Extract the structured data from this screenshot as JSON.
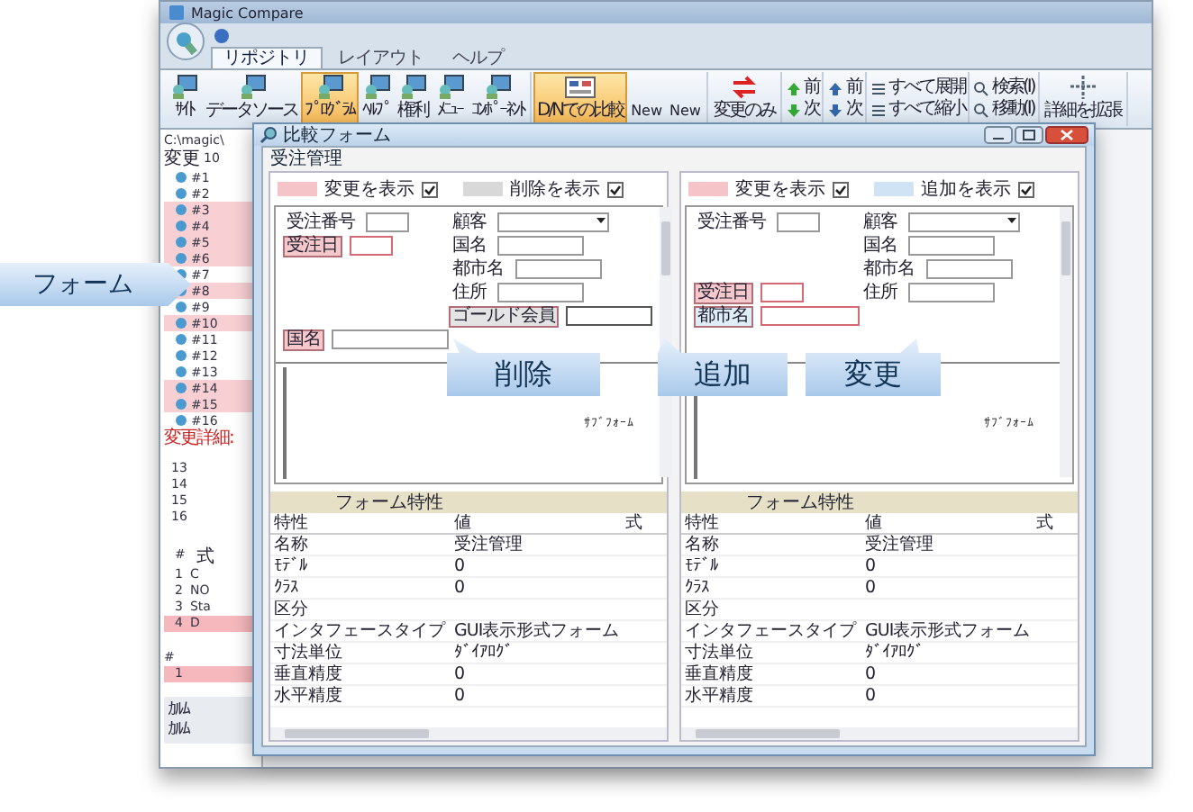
{
  "app": {
    "title": "Magic Compare",
    "tabs": [
      {
        "label": "リポジトリ",
        "selected": true
      },
      {
        "label": "レイアウト",
        "selected": false
      },
      {
        "label": "ヘルプ",
        "selected": false
      }
    ],
    "ribbon": [
      {
        "items": [
          {
            "kind": "large",
            "label": "ｻｲﾄ",
            "selected": false
          },
          {
            "kind": "large",
            "label": "データソース",
            "selected": false
          },
          {
            "kind": "large",
            "label": "ﾌﾟﾛｸﾞﾗﾑ",
            "selected": true
          },
          {
            "kind": "large",
            "label": "ﾍﾙﾌﾟ",
            "selected": false
          },
          {
            "kind": "large",
            "label": "権利",
            "selected": false
          },
          {
            "kind": "large",
            "label": "ﾒﾆｭｰ",
            "selected": false
          },
          {
            "kind": "large",
            "label": "ｺﾝﾎﾟｰﾈﾝﾄ",
            "selected": false
          }
        ]
      },
      {
        "items": [
          {
            "kind": "large",
            "label": "D/Nでの比較",
            "selected": true
          },
          {
            "kind": "text",
            "label": "New"
          },
          {
            "kind": "text",
            "label": "New"
          }
        ]
      },
      {
        "items": [
          {
            "kind": "large",
            "label": "変更のみ",
            "selected": false
          }
        ]
      },
      {
        "items": [
          {
            "kind": "small",
            "label": "前"
          },
          {
            "kind": "small",
            "label": "次"
          }
        ]
      },
      {
        "items": [
          {
            "kind": "small",
            "label": "前"
          },
          {
            "kind": "small",
            "label": "次"
          }
        ]
      },
      {
        "items": [
          {
            "kind": "small",
            "label": "すべて展開"
          },
          {
            "kind": "small",
            "label": "すべて縮小"
          }
        ]
      },
      {
        "items": [
          {
            "kind": "small",
            "label": "検索(I)"
          },
          {
            "kind": "small",
            "label": "移動(I)"
          }
        ]
      },
      {
        "items": [
          {
            "kind": "large",
            "label": "詳細を拡張",
            "selected": false
          }
        ]
      }
    ],
    "path": "C:\\magic\\",
    "changes_label": "変更",
    "changes_count": "10",
    "tree": [
      {
        "label": "#1",
        "highlight": false
      },
      {
        "label": "#2",
        "highlight": false
      },
      {
        "label": "#3",
        "highlight": true
      },
      {
        "label": "#4",
        "highlight": true
      },
      {
        "label": "#5",
        "highlight": true
      },
      {
        "label": "#6",
        "highlight": true
      },
      {
        "label": "#7",
        "highlight": false
      },
      {
        "label": "#8",
        "highlight": true
      },
      {
        "label": "#9",
        "highlight": false
      },
      {
        "label": "#10",
        "highlight": true
      },
      {
        "label": "#11",
        "highlight": false
      },
      {
        "label": "#12",
        "highlight": false
      },
      {
        "label": "#13",
        "highlight": false
      },
      {
        "label": "#14",
        "highlight": true
      },
      {
        "label": "#15",
        "highlight": true
      },
      {
        "label": "#16",
        "highlight": false
      }
    ],
    "detail_label": "変更詳細:",
    "lines": [
      "13",
      "14",
      "15",
      "16"
    ],
    "expr_header": [
      "#",
      "式"
    ],
    "expressions": [
      {
        "num": "1",
        "text": "C",
        "highlight": false
      },
      {
        "num": "2",
        "text": "NO",
        "highlight": false
      },
      {
        "num": "3",
        "text": "Sta",
        "highlight": false
      },
      {
        "num": "4",
        "text": "D",
        "highlight": true
      }
    ],
    "column_header": "#",
    "column_rows": [
      {
        "num": "1",
        "highlight": true
      }
    ],
    "footer": [
      "ｶﾙﾑ",
      "ｶﾙﾑ"
    ]
  },
  "dialog": {
    "title": "比較フォーム",
    "form_name": "受注管理",
    "panes": [
      {
        "legend": [
          {
            "label": "変更を表示",
            "color": "#f4c4c8",
            "checked": true
          },
          {
            "label": "削除を表示",
            "color": "#d8d8d8",
            "checked": true
          }
        ],
        "rows": [
          {
            "left": {
              "kind": "text",
              "label": {
                "text": "受注番号"
              }
            },
            "right": {
              "kind": "combo",
              "label": {
                "text": "顧客"
              }
            }
          },
          {
            "left": {
              "kind": "text",
              "label": {
                "text": "受注日",
                "color": "#f6c8cc"
              },
              "field": {
                "color": "#d46a74"
              }
            },
            "right": {
              "kind": "text",
              "label": {
                "text": "国名"
              }
            }
          },
          {
            "right": {
              "kind": "text",
              "label": {
                "text": "都市名"
              }
            }
          },
          {
            "right": {
              "kind": "text",
              "label": {
                "text": "住所"
              }
            }
          },
          {
            "right": {
              "kind": "text",
              "label": {
                "text": "ゴールド会員",
                "color": "#e4e4e4"
              },
              "field": {
                "color": "#555555"
              }
            }
          },
          {
            "left": {
              "kind": "wide",
              "label": {
                "text": "国名",
                "color": "#f6c8cc"
              }
            }
          }
        ],
        "subform": "ｻﾌﾞﾌｫｰﾑ",
        "section": "フォーム特性",
        "columns": [
          "特性",
          "値",
          "式"
        ],
        "properties": [
          {
            "name": "名称",
            "value": "受注管理"
          },
          {
            "name": "ﾓﾃﾞﾙ",
            "value": "0"
          },
          {
            "name": "ｸﾗｽ",
            "value": "0"
          },
          {
            "name": "区分"
          },
          {
            "name": "インタフェースタイプ",
            "value": "GUI表示形式フォーム"
          },
          {
            "name": "寸法単位",
            "value": "ﾀﾞｲｱﾛｸﾞ"
          },
          {
            "name": "垂直精度",
            "value": "0"
          },
          {
            "name": "水平精度",
            "value": "0"
          }
        ]
      },
      {
        "legend": [
          {
            "label": "変更を表示",
            "color": "#f4c4c8",
            "checked": true
          },
          {
            "label": "追加を表示",
            "color": "#cfe3f5",
            "checked": true
          }
        ],
        "rows": [
          {
            "left": {
              "kind": "text",
              "label": {
                "text": "受注番号"
              }
            },
            "right": {
              "kind": "combo",
              "label": {
                "text": "顧客"
              }
            }
          },
          {
            "right": {
              "kind": "text",
              "label": {
                "text": "国名"
              }
            }
          },
          {
            "right": {
              "kind": "text",
              "label": {
                "text": "都市名"
              }
            }
          },
          {
            "left": {
              "kind": "text",
              "label": {
                "text": "受注日",
                "color": "#f6c8cc"
              },
              "field": {
                "color": "#d46a74"
              }
            },
            "right": {
              "kind": "text",
              "label": {
                "text": "住所"
              }
            }
          },
          {
            "left": {
              "kind": "wide",
              "label": {
                "text": "都市名",
                "color": "#e0eefa"
              },
              "field": {
                "color": "#d46a74"
              }
            }
          }
        ],
        "subform": "ｻﾌﾞﾌｫｰﾑ",
        "section": "フォーム特性",
        "columns": [
          "特性",
          "値",
          "式"
        ],
        "properties": [
          {
            "name": "名称",
            "value": "受注管理"
          },
          {
            "name": "ﾓﾃﾞﾙ",
            "value": "0"
          },
          {
            "name": "ｸﾗｽ",
            "value": "0"
          },
          {
            "name": "区分"
          },
          {
            "name": "インタフェースタイプ",
            "value": "GUI表示形式フォーム"
          },
          {
            "name": "寸法単位",
            "value": "ﾀﾞｲｱﾛｸﾞ"
          },
          {
            "name": "垂直精度",
            "value": "0"
          },
          {
            "name": "水平精度",
            "value": "0"
          }
        ]
      }
    ]
  },
  "callouts": [
    {
      "text": "フォーム"
    },
    {
      "text": "削除"
    },
    {
      "text": "追加"
    },
    {
      "text": "変更"
    }
  ]
}
